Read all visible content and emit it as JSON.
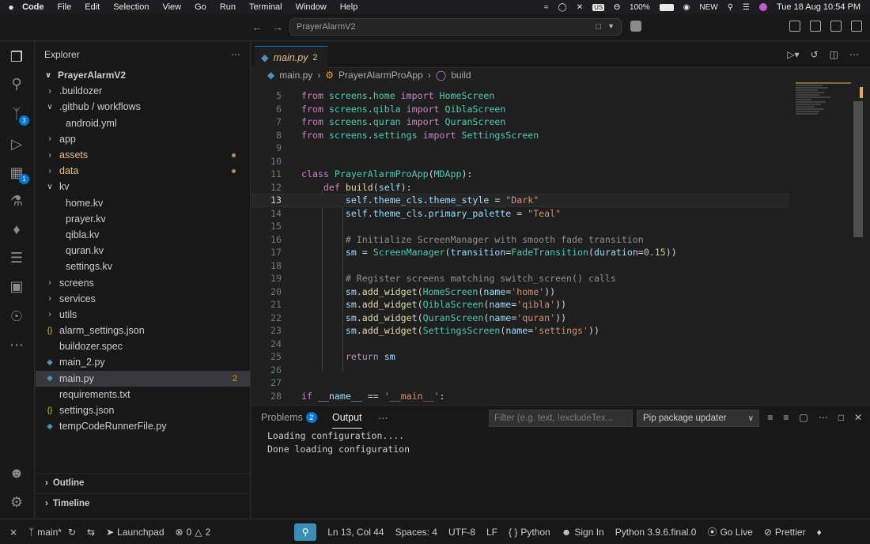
{
  "menubar": {
    "app": "Code",
    "items": [
      "File",
      "Edit",
      "Selection",
      "View",
      "Go",
      "Run",
      "Terminal",
      "Window",
      "Help"
    ],
    "battery": "100%",
    "status_new": "NEW",
    "input_source": "US",
    "datetime": "Tue 18 Aug  10:54 PM"
  },
  "titlebar": {
    "command_center": "PrayerAlarmV2"
  },
  "activity": {
    "scm_badge": "3",
    "extensions_badge": "1"
  },
  "sidebar": {
    "title": "Explorer",
    "root": "PrayerAlarmV2",
    "rows": [
      {
        "label": ".buildozer",
        "type": "folder",
        "indent": 1
      },
      {
        "label": ".github / workflows",
        "type": "folder-open",
        "indent": 1
      },
      {
        "label": "android.yml",
        "type": "file",
        "indent": 2
      },
      {
        "label": "app",
        "type": "folder",
        "indent": 1
      },
      {
        "label": "assets",
        "type": "folder",
        "indent": 1,
        "modified": true
      },
      {
        "label": "data",
        "type": "folder",
        "indent": 1,
        "modified": true
      },
      {
        "label": "kv",
        "type": "folder-open",
        "indent": 1
      },
      {
        "label": "home.kv",
        "type": "file",
        "indent": 2
      },
      {
        "label": "prayer.kv",
        "type": "file",
        "indent": 2
      },
      {
        "label": "qibla.kv",
        "type": "file",
        "indent": 2
      },
      {
        "label": "quran.kv",
        "type": "file",
        "indent": 2
      },
      {
        "label": "settings.kv",
        "type": "file",
        "indent": 2
      },
      {
        "label": "screens",
        "type": "folder",
        "indent": 1
      },
      {
        "label": "services",
        "type": "folder",
        "indent": 1
      },
      {
        "label": "utils",
        "type": "folder",
        "indent": 1
      },
      {
        "label": "alarm_settings.json",
        "type": "json",
        "indent": 1
      },
      {
        "label": "buildozer.spec",
        "type": "file",
        "indent": 1
      },
      {
        "label": "main_2.py",
        "type": "py",
        "indent": 1
      },
      {
        "label": "main.py",
        "type": "py",
        "indent": 1,
        "selected": true,
        "count": "2"
      },
      {
        "label": "requirements.txt",
        "type": "file",
        "indent": 1
      },
      {
        "label": "settings.json",
        "type": "json",
        "indent": 1
      },
      {
        "label": "tempCodeRunnerFile.py",
        "type": "py",
        "indent": 1
      }
    ],
    "outline": "Outline",
    "timeline": "Timeline"
  },
  "editor": {
    "tab_label": "main.py",
    "tab_count": "2",
    "breadcrumb": [
      "main.py",
      "PrayerAlarmProApp",
      "build"
    ],
    "lines": [
      {
        "n": "5",
        "html": "<span class='kw'>from</span> <span class='mod'>screens</span>.<span class='mod'>home</span> <span class='kw'>import</span> <span class='cls'>HomeScreen</span>"
      },
      {
        "n": "6",
        "html": "<span class='kw'>from</span> <span class='mod'>screens</span>.<span class='mod'>qibla</span> <span class='kw'>import</span> <span class='cls'>QiblaScreen</span>"
      },
      {
        "n": "7",
        "html": "<span class='kw'>from</span> <span class='mod'>screens</span>.<span class='mod'>quran</span> <span class='kw'>import</span> <span class='cls'>QuranScreen</span>"
      },
      {
        "n": "8",
        "html": "<span class='kw'>from</span> <span class='mod'>screens</span>.<span class='mod'>settings</span> <span class='kw'>import</span> <span class='cls'>SettingsScreen</span>"
      },
      {
        "n": "9",
        "html": ""
      },
      {
        "n": "10",
        "html": ""
      },
      {
        "n": "11",
        "html": "<span class='kw'>class</span> <span class='cls'>PrayerAlarmProApp</span>(<span class='cls'>MDApp</span>):"
      },
      {
        "n": "12",
        "html": "    <span class='kw'>def</span> <span class='fn'>build</span>(<span class='param'>self</span>):"
      },
      {
        "n": "13",
        "html": "        <span class='self'>self</span>.<span class='param'>theme_cls</span>.<span class='param'>theme_style</span> = <span class='str'>\"Dark\"</span>",
        "current": true
      },
      {
        "n": "14",
        "html": "        <span class='self'>self</span>.<span class='param'>theme_cls</span>.<span class='param'>primary_palette</span> = <span class='str'>\"Teal\"</span>"
      },
      {
        "n": "15",
        "html": ""
      },
      {
        "n": "16",
        "html": "        <span class='cm'># Initialize ScreenManager with smooth fade transition</span>"
      },
      {
        "n": "17",
        "html": "        <span class='param'>sm</span> = <span class='cls'>ScreenManager</span>(<span class='param'>transition</span>=<span class='cls'>FadeTransition</span>(<span class='param'>duration</span>=<span class='num'>0.15</span>))"
      },
      {
        "n": "18",
        "html": ""
      },
      {
        "n": "19",
        "html": "        <span class='cm'># Register screens matching switch_screen() calls</span>"
      },
      {
        "n": "20",
        "html": "        <span class='param'>sm</span>.<span class='fn'>add_widget</span>(<span class='cls'>HomeScreen</span>(<span class='param'>name</span>=<span class='str'>'home'</span>))"
      },
      {
        "n": "21",
        "html": "        <span class='param'>sm</span>.<span class='fn'>add_widget</span>(<span class='cls'>QiblaScreen</span>(<span class='param'>name</span>=<span class='str'>'qibla'</span>))"
      },
      {
        "n": "22",
        "html": "        <span class='param'>sm</span>.<span class='fn'>add_widget</span>(<span class='cls'>QuranScreen</span>(<span class='param'>name</span>=<span class='str'>'quran'</span>))"
      },
      {
        "n": "23",
        "html": "        <span class='param'>sm</span>.<span class='fn'>add_widget</span>(<span class='cls'>SettingsScreen</span>(<span class='param'>name</span>=<span class='str'>'settings'</span>))"
      },
      {
        "n": "24",
        "html": ""
      },
      {
        "n": "25",
        "html": "        <span class='kw'>return</span> <span class='param'>sm</span>"
      },
      {
        "n": "26",
        "html": ""
      },
      {
        "n": "27",
        "html": ""
      },
      {
        "n": "28",
        "html": "<span class='kw'>if</span> <span class='param'>__name__</span> == <span class='str'>'__main__'</span>:"
      }
    ]
  },
  "panel": {
    "tabs": [
      {
        "label": "Problems",
        "badge": "2"
      },
      {
        "label": "Output"
      }
    ],
    "filter_placeholder": "Filter (e.g. text, !excludeTex...",
    "channel": "Pip package updater",
    "output": "Loading configuration....\nDone loading configuration"
  },
  "statusbar": {
    "branch": "main*",
    "launchpad": "Launchpad",
    "errors": "0",
    "warnings": "2",
    "position": "Ln 13, Col 44",
    "spaces": "Spaces: 4",
    "encoding": "UTF-8",
    "eol": "LF",
    "language": "Python",
    "signin": "Sign In",
    "interpreter": "Python 3.9.6.final.0",
    "golive": "Go Live",
    "prettier": "Prettier"
  }
}
